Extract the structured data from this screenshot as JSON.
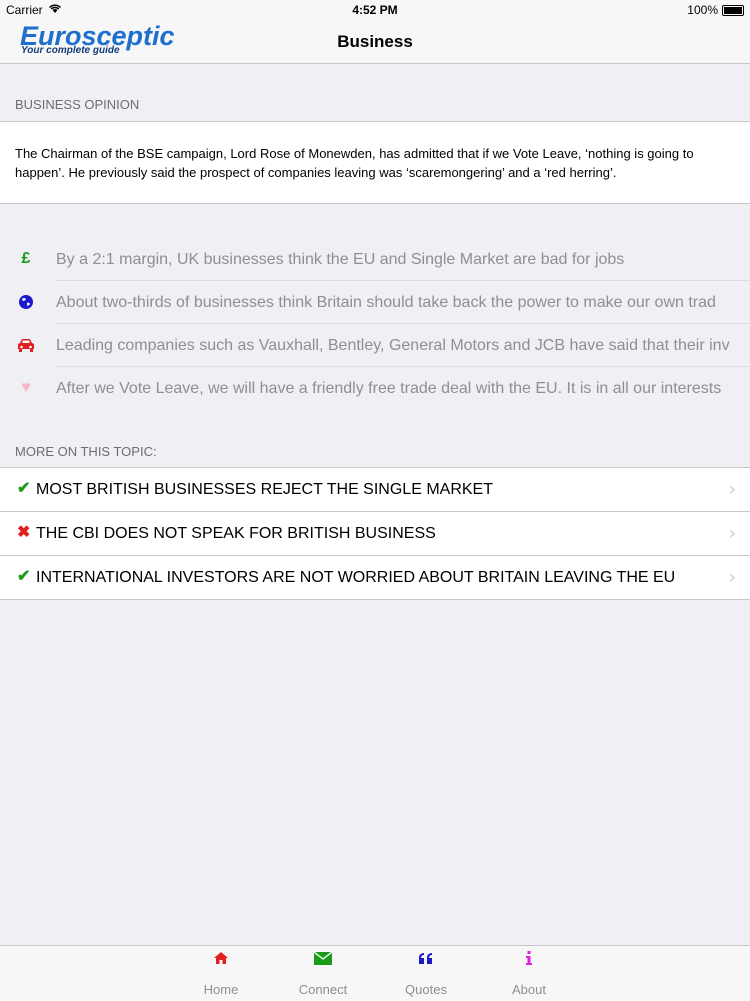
{
  "status_bar": {
    "carrier": "Carrier",
    "time": "4:52 PM",
    "battery": "100%"
  },
  "nav": {
    "brand": "Eurosceptic",
    "tagline": "Your complete guide",
    "title": "Business"
  },
  "opinion": {
    "header": "BUSINESS OPINION",
    "text": "The Chairman of the BSE campaign, Lord Rose of Monewden, has admitted that if we Vote Leave, ‘nothing is going to happen’. He previously said the prospect of companies leaving was ‘scaremongering’ and a ‘red herring’."
  },
  "facts": [
    {
      "icon": "pound-icon",
      "glyph": "£",
      "color": "#1a9c1a",
      "text": "By a 2:1 margin, UK businesses think the EU and Single Market are bad for jobs"
    },
    {
      "icon": "globe-icon",
      "glyph": "",
      "color": "#1a1acc",
      "text": "About two-thirds of businesses think Britain should take back the power to make our own trad"
    },
    {
      "icon": "car-icon",
      "glyph": "",
      "color": "#e02020",
      "text": "Leading companies such as Vauxhall, Bentley, General Motors and JCB have said that their inv"
    },
    {
      "icon": "heart-icon",
      "glyph": "♥",
      "color": "#f5b8c8",
      "text": "After we Vote Leave, we will have a friendly free trade deal with the EU. It is in all our interests"
    }
  ],
  "more": {
    "header": "MORE ON THIS TOPIC:",
    "items": [
      {
        "mark": "✔",
        "mark_icon": "check-icon",
        "mark_color": "#1a9c1a",
        "text": "MOST BRITISH BUSINESSES REJECT THE SINGLE MARKET"
      },
      {
        "mark": "✖",
        "mark_icon": "cross-icon",
        "mark_color": "#e02020",
        "text": "THE CBI DOES NOT SPEAK FOR BRITISH BUSINESS"
      },
      {
        "mark": "✔",
        "mark_icon": "check-icon",
        "mark_color": "#1a9c1a",
        "text": "INTERNATIONAL INVESTORS ARE NOT WORRIED ABOUT BRITAIN LEAVING THE EU"
      }
    ]
  },
  "tabs": [
    {
      "label": "Home",
      "icon": "home-icon",
      "color": "#e02020"
    },
    {
      "label": "Connect",
      "icon": "envelope-icon",
      "color": "#1a9c1a"
    },
    {
      "label": "Quotes",
      "icon": "quote-icon",
      "color": "#1a1acc"
    },
    {
      "label": "About",
      "icon": "info-icon",
      "color": "#e020e0"
    }
  ]
}
